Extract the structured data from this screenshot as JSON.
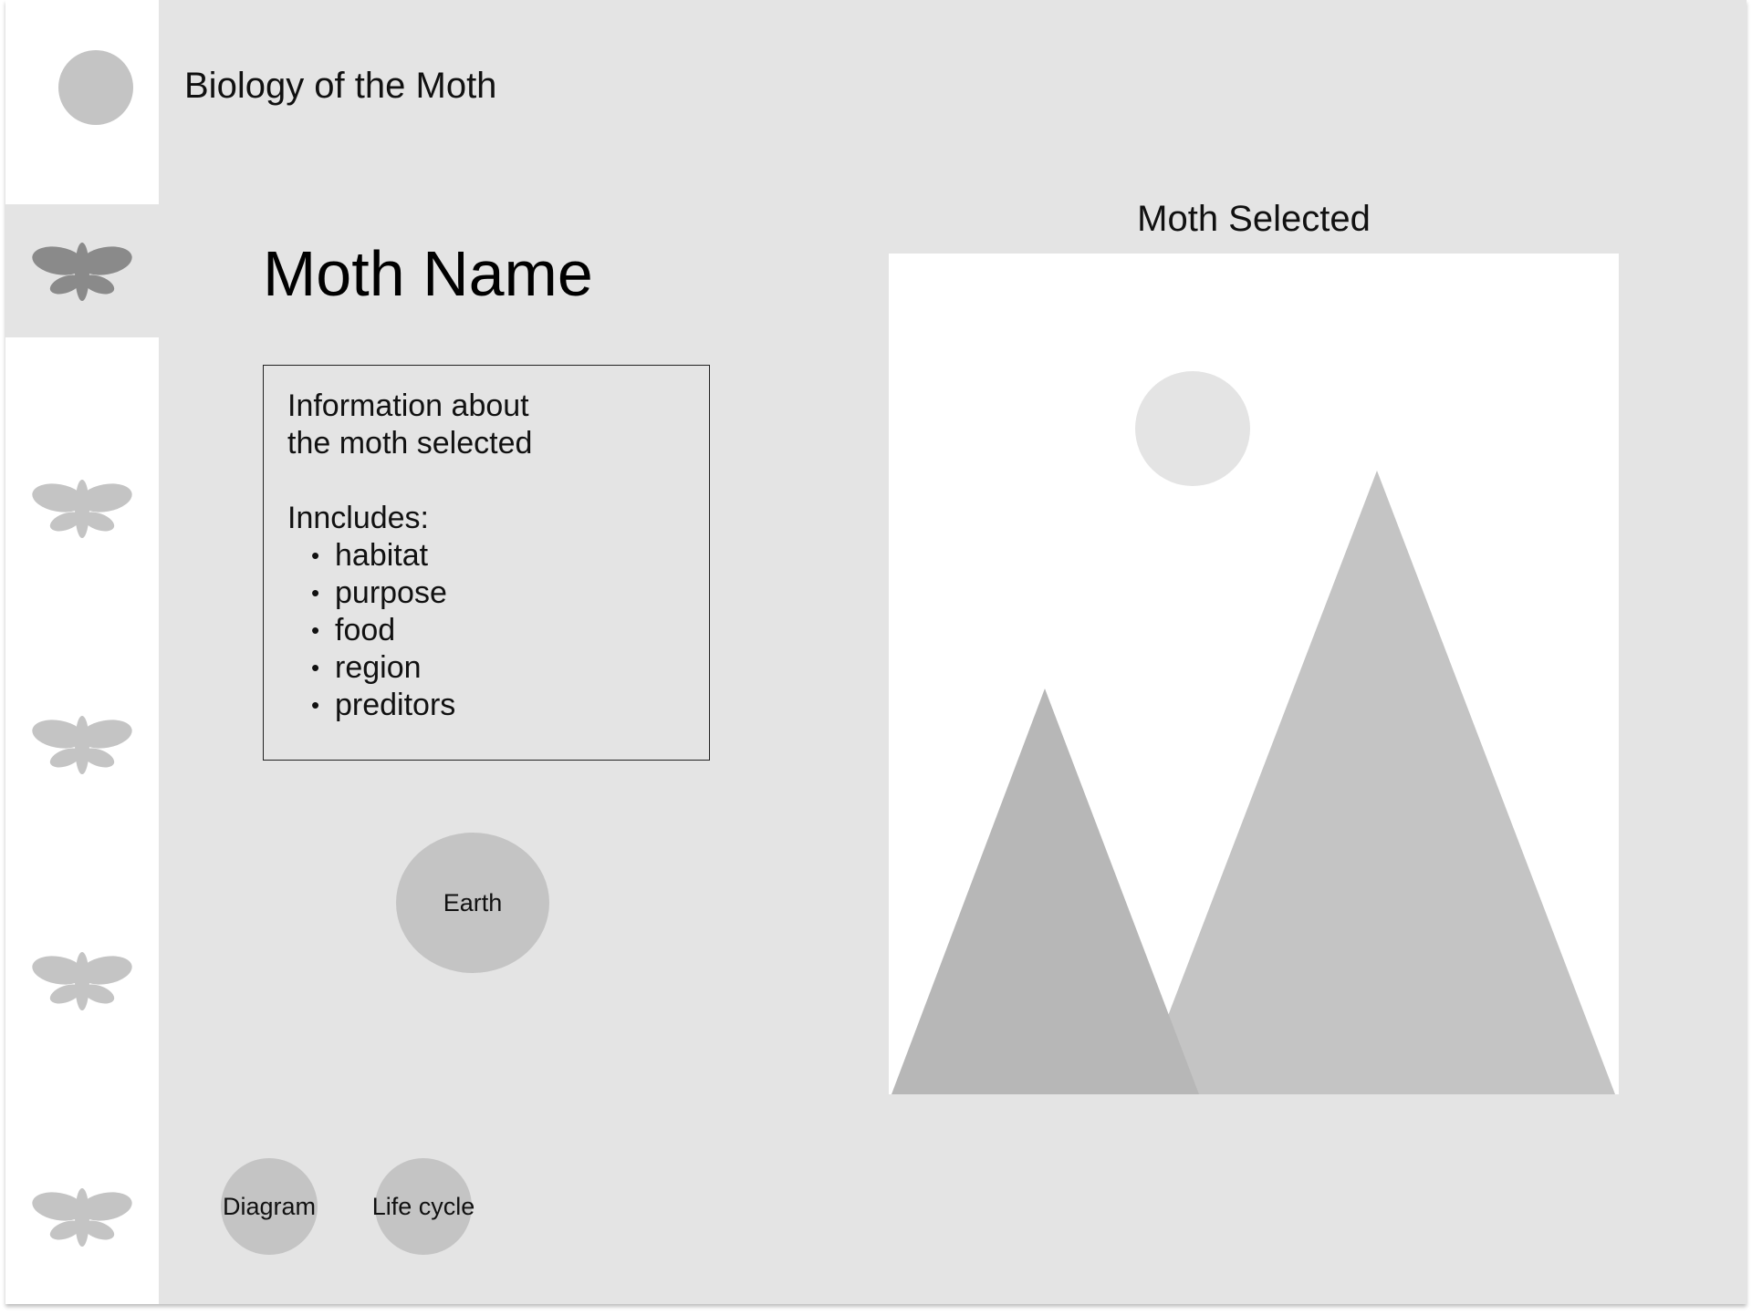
{
  "header": {
    "title": "Biology of the Moth"
  },
  "sidebar": {
    "items": [
      {
        "icon": "moth-icon",
        "active": true
      },
      {
        "icon": "moth-icon",
        "active": false
      },
      {
        "icon": "moth-icon",
        "active": false
      },
      {
        "icon": "moth-icon",
        "active": false
      },
      {
        "icon": "moth-icon",
        "active": false
      }
    ]
  },
  "main": {
    "moth_name": "Moth Name",
    "info": {
      "line1": "Information about",
      "line2": "the moth selected",
      "includes_label": "Inncludes:",
      "items": [
        "habitat",
        "purpose",
        "food",
        "region",
        "preditors"
      ]
    },
    "buttons": {
      "earth": "Earth",
      "diagram": "Diagram",
      "life_cycle": "Life cycle"
    },
    "image_panel": {
      "label": "Moth Selected",
      "placeholder_icon": "image-placeholder-icon"
    }
  },
  "colors": {
    "background": "#e4e4e4",
    "sidebar": "#ffffff",
    "placeholder": "#c4c4c4",
    "active_icon": "#8a8a8a",
    "inactive_icon": "#c4c4c4"
  }
}
